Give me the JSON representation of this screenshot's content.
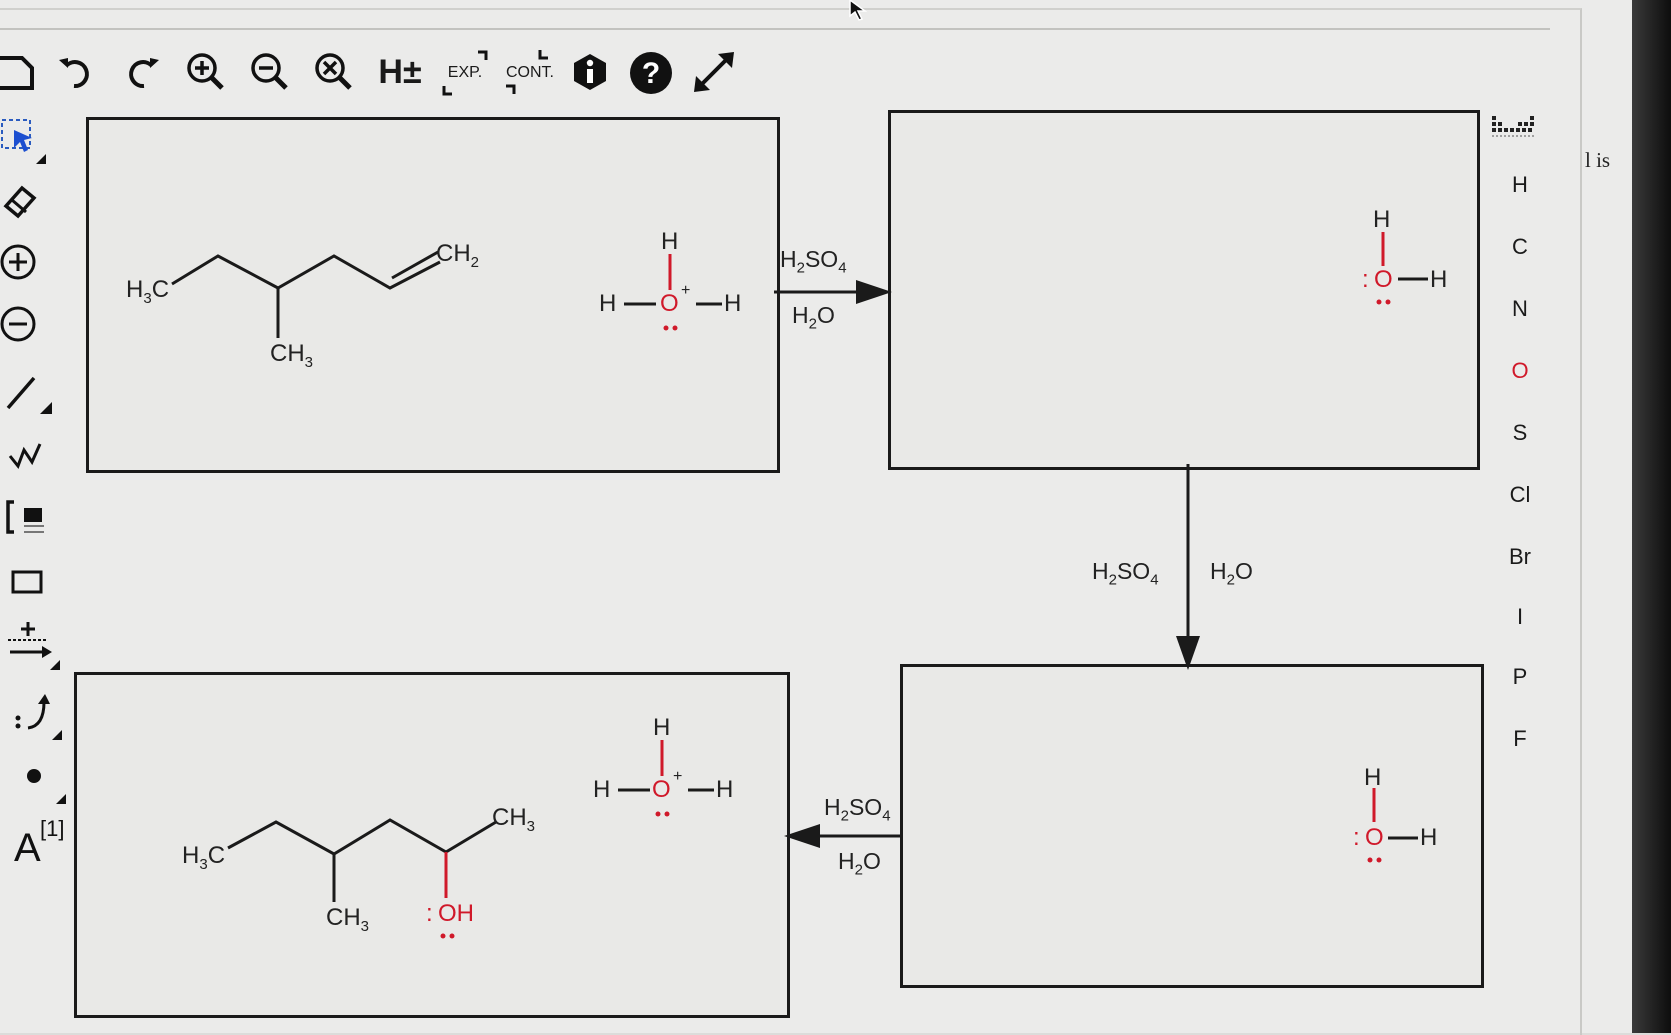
{
  "toolbar": {
    "icons": [
      "new-document-icon",
      "undo-icon",
      "redo-icon",
      "zoom-in-icon",
      "zoom-out-icon",
      "zoom-reset-icon",
      "h-toggle-icon",
      "expand-icon",
      "contract-icon",
      "info-icon",
      "help-icon",
      "fullscreen-icon"
    ],
    "h_label": "H±",
    "exp_label": "EXP.",
    "cont_label": "CONT."
  },
  "left_tools": {
    "icons": [
      "select-arrow-icon",
      "eraser-icon",
      "charge-plus-icon",
      "charge-minus-icon",
      "bond-line-icon",
      "chain-icon",
      "bracket-icon",
      "rectangle-icon",
      "reaction-arrow-icon",
      "curved-arrow-icon",
      "electron-dot-icon",
      "atom-label-icon"
    ],
    "atom_label": "A",
    "atom_label_sup": "[1]"
  },
  "element_palette": {
    "grid_icon": "periodic-table-icon",
    "elements": [
      "H",
      "C",
      "N",
      "O",
      "S",
      "Cl",
      "Br",
      "I",
      "P",
      "F"
    ],
    "highlight_color": "#d0192a"
  },
  "side_text": "l is",
  "panels": {
    "box1": {
      "h3c": "H",
      "h3c_sub": "3",
      "h3c_c": "C",
      "ch2": "CH",
      "ch2_sub": "2",
      "ch3": "CH",
      "ch3_sub": "3",
      "hydronium": {
        "top_h": "H",
        "left_h": "H",
        "o": "O",
        "charge": "+",
        "right_h": "H"
      }
    },
    "box2": {
      "water": {
        "top_h": "H",
        "o": "O",
        "right_h": "H",
        "lone_pair": ":"
      }
    },
    "box3": {
      "water": {
        "top_h": "H",
        "o": "O",
        "right_h": "H",
        "lone_pair": ":"
      }
    },
    "box4": {
      "h3c": "H",
      "h3c_sub": "3",
      "h3c_c": "C",
      "ch3_right": "CH",
      "ch3_right_sub": "3",
      "ch3_bottom": "CH",
      "ch3_bottom_sub": "3",
      "oh": "OH",
      "oh_lone": ":",
      "hydronium": {
        "top_h": "H",
        "left_h": "H",
        "o": "O",
        "charge": "+",
        "right_h": "H"
      }
    }
  },
  "reagents": {
    "arrow1": {
      "top": "H",
      "top_sub": "2",
      "top_rest": "SO",
      "top_sub2": "4",
      "bottom": "H",
      "bottom_sub": "2",
      "bottom_rest": "O"
    },
    "arrow2": {
      "left": "H",
      "left_sub": "2",
      "left_rest": "SO",
      "left_sub2": "4",
      "right": "H",
      "right_sub": "2",
      "right_rest": "O"
    },
    "arrow3": {
      "top": "H",
      "top_sub": "2",
      "top_rest": "SO",
      "top_sub2": "4",
      "bottom": "H",
      "bottom_sub": "2",
      "bottom_rest": "O"
    }
  },
  "colors": {
    "oxygen": "#d0192a",
    "ink": "#1a1a1a"
  }
}
